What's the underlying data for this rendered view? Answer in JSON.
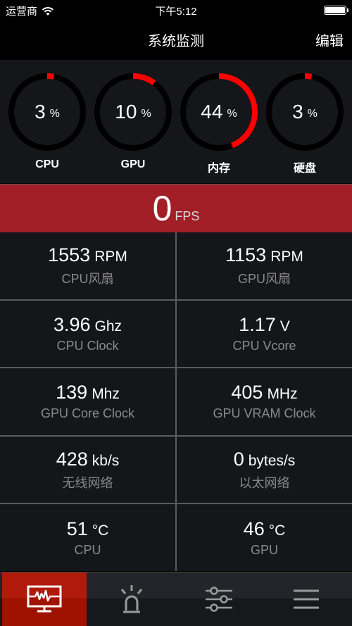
{
  "status_bar": {
    "carrier": "运营商",
    "time": "下午5:12",
    "icons": {
      "wifi": "wifi-icon",
      "battery": "battery-icon"
    }
  },
  "nav": {
    "title": "系统监测",
    "edit_label": "编辑"
  },
  "gauges": [
    {
      "label": "CPU",
      "value": "3",
      "unit": "%",
      "percent": 3
    },
    {
      "label": "GPU",
      "value": "10",
      "unit": "%",
      "percent": 10
    },
    {
      "label": "内存",
      "value": "44",
      "unit": "%",
      "percent": 44
    },
    {
      "label": "硬盘",
      "value": "3",
      "unit": "%",
      "percent": 3
    }
  ],
  "fps": {
    "value": "0",
    "unit": "FPS"
  },
  "metrics": [
    {
      "value": "1553",
      "unit": "RPM",
      "label": "CPU风扇"
    },
    {
      "value": "1153",
      "unit": "RPM",
      "label": "GPU风扇"
    },
    {
      "value": "3.96",
      "unit": "Ghz",
      "label": "CPU Clock"
    },
    {
      "value": "1.17",
      "unit": "V",
      "label": "CPU Vcore"
    },
    {
      "value": "139",
      "unit": "Mhz",
      "label": "GPU Core Clock"
    },
    {
      "value": "405",
      "unit": "MHz",
      "label": "GPU VRAM Clock"
    },
    {
      "value": "428",
      "unit": "kb/s",
      "label": "无线网络"
    },
    {
      "value": "0",
      "unit": "bytes/s",
      "label": "以太网络"
    },
    {
      "value": "51",
      "unit": "°C",
      "label": "CPU"
    },
    {
      "value": "46",
      "unit": "°C",
      "label": "GPU"
    }
  ],
  "tabs": [
    {
      "name": "monitor",
      "icon": "monitor-pulse-icon",
      "active": true
    },
    {
      "name": "alerts",
      "icon": "alarm-siren-icon",
      "active": false
    },
    {
      "name": "settings",
      "icon": "sliders-icon",
      "active": false
    },
    {
      "name": "menu",
      "icon": "hamburger-menu-icon",
      "active": false
    }
  ],
  "colors": {
    "accent": "#ff0000",
    "ring_track": "#000000",
    "fps_bg": "#a21f27",
    "tab_active": "#b01a0a",
    "panel_bg": "#15161a",
    "label_gray": "#8a8a8a"
  }
}
